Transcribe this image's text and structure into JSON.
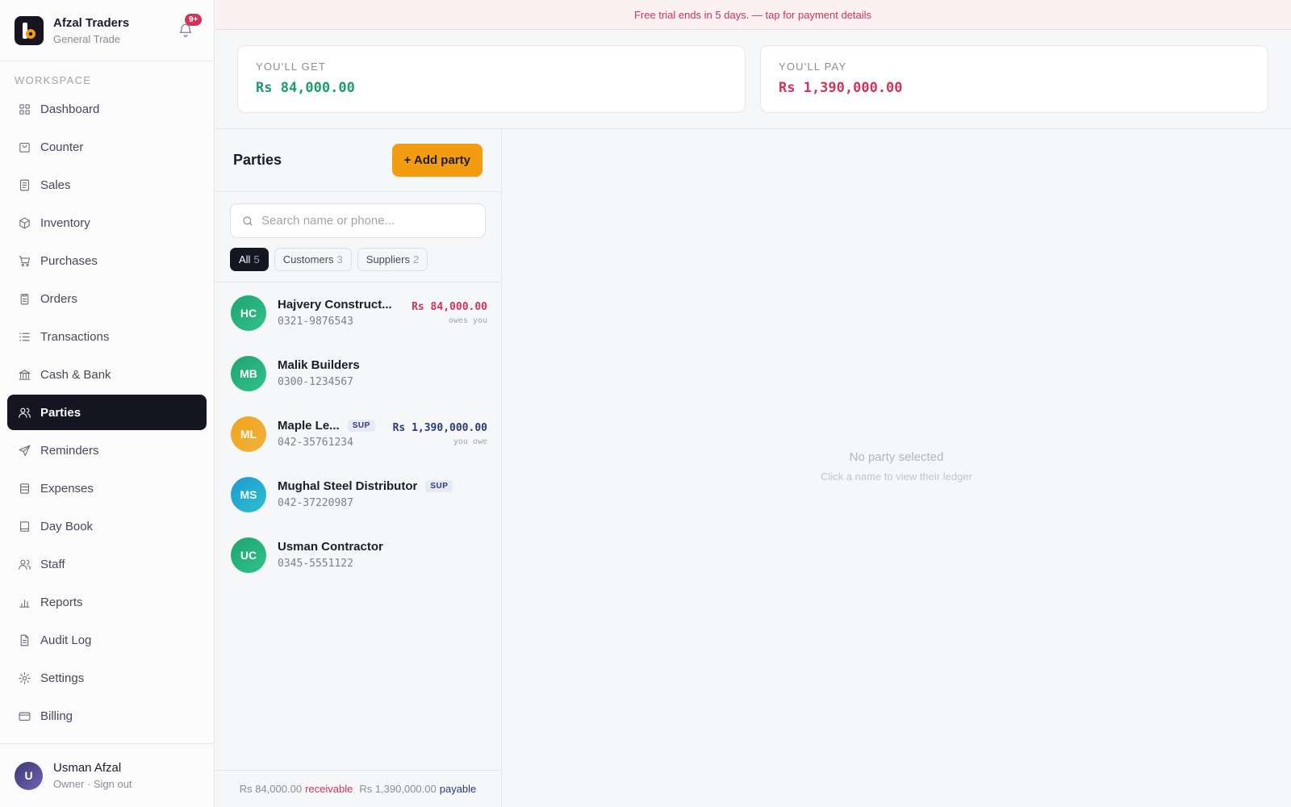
{
  "brand": {
    "name": "Afzal Traders",
    "subtitle": "General Trade",
    "notification_badge": "9+"
  },
  "sidebar": {
    "section_label": "WORKSPACE",
    "items": [
      {
        "label": "Dashboard",
        "icon": "grid-icon"
      },
      {
        "label": "Counter",
        "icon": "bag-icon"
      },
      {
        "label": "Sales",
        "icon": "receipt-icon"
      },
      {
        "label": "Inventory",
        "icon": "box-icon"
      },
      {
        "label": "Purchases",
        "icon": "cart-icon"
      },
      {
        "label": "Orders",
        "icon": "clipboard-icon"
      },
      {
        "label": "Transactions",
        "icon": "list-icon"
      },
      {
        "label": "Cash & Bank",
        "icon": "bank-icon"
      },
      {
        "label": "Parties",
        "icon": "users-icon",
        "active": true
      },
      {
        "label": "Reminders",
        "icon": "send-icon"
      },
      {
        "label": "Expenses",
        "icon": "stack-icon"
      },
      {
        "label": "Day Book",
        "icon": "book-icon"
      },
      {
        "label": "Staff",
        "icon": "staff-icon"
      },
      {
        "label": "Reports",
        "icon": "bar-chart-icon"
      },
      {
        "label": "Audit Log",
        "icon": "document-icon"
      },
      {
        "label": "Settings",
        "icon": "gear-icon"
      },
      {
        "label": "Billing",
        "icon": "card-icon"
      }
    ]
  },
  "user": {
    "initial": "U",
    "name": "Usman Afzal",
    "subtitle": "Owner · Sign out"
  },
  "trial_banner": "Free trial ends in 5 days. — tap for payment details",
  "summary": {
    "get": {
      "label": "YOU'LL GET",
      "value": "Rs 84,000.00"
    },
    "pay": {
      "label": "YOU'LL PAY",
      "value": "Rs 1,390,000.00"
    }
  },
  "parties": {
    "title": "Parties",
    "add_label": "+ Add party",
    "search_placeholder": "Search name or phone...",
    "filters": [
      {
        "label": "All",
        "count": "5",
        "active": true
      },
      {
        "label": "Customers",
        "count": "3"
      },
      {
        "label": "Suppliers",
        "count": "2"
      }
    ],
    "list": [
      {
        "initials": "HC",
        "name": "Hajvery Construct...",
        "phone": "0321-9876543",
        "tag": "",
        "balance": "Rs 84,000.00",
        "balance_note": "owes you",
        "avatar_color": "green",
        "balance_color": "red"
      },
      {
        "initials": "MB",
        "name": "Malik Builders",
        "phone": "0300-1234567",
        "tag": "",
        "balance": "",
        "balance_note": "",
        "avatar_color": "green",
        "balance_color": ""
      },
      {
        "initials": "ML",
        "name": "Maple Le...",
        "phone": "042-35761234",
        "tag": "SUP",
        "balance": "Rs 1,390,000.00",
        "balance_note": "you owe",
        "avatar_color": "orange",
        "balance_color": "navy"
      },
      {
        "initials": "MS",
        "name": "Mughal Steel Distributor",
        "phone": "042-37220987",
        "tag": "SUP",
        "balance": "",
        "balance_note": "",
        "avatar_color": "teal",
        "balance_color": ""
      },
      {
        "initials": "UC",
        "name": "Usman Contractor",
        "phone": "0345-5551122",
        "tag": "",
        "balance": "",
        "balance_note": "",
        "avatar_color": "green",
        "balance_color": ""
      }
    ],
    "footer": {
      "receivable_amount": "Rs 84,000.00",
      "receivable_label": "receivable",
      "payable_amount": "Rs 1,390,000.00",
      "payable_label": "payable"
    }
  },
  "ledger": {
    "empty_title": "No party selected",
    "empty_subtitle": "Click a name to view their ledger"
  },
  "colors": {
    "accent": "#f39c12",
    "dark": "#151622",
    "positive": "#1f9a6b",
    "negative": "#d0345a",
    "navy": "#283a78"
  }
}
